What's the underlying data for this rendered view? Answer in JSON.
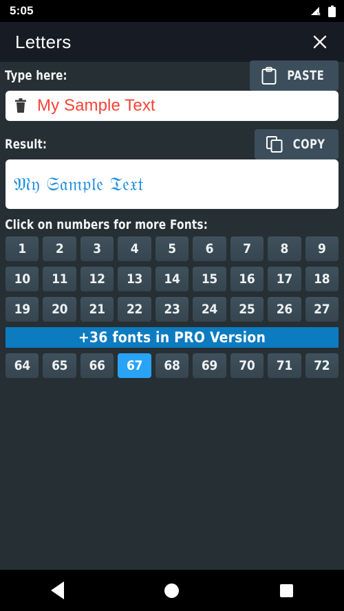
{
  "status_bar": {
    "time": "5:05",
    "signal_icon": "signal-no-sim-icon",
    "battery_icon": "battery-full-icon"
  },
  "title_bar": {
    "title": "Letters",
    "close_icon": "close-icon"
  },
  "input_section": {
    "label": "Type here:",
    "paste_button": {
      "label": "PASTE",
      "icon": "clipboard-icon"
    },
    "clear_icon": "trash-icon",
    "value": "My Sample Text",
    "placeholder": "Type here",
    "text_color": "#f44336"
  },
  "result_section": {
    "label": "Result:",
    "copy_button": {
      "label": "COPY",
      "icon": "copy-icon"
    },
    "value": "𝔐𝔶 𝔖𝔞𝔪𝔭𝔩𝔢 𝔗𝔢𝔵𝔱",
    "text_color": "#1e8fdb"
  },
  "fonts_section": {
    "hint": "Click on numbers for more Fonts:",
    "rows": [
      [
        "1",
        "2",
        "3",
        "4",
        "5",
        "6",
        "7",
        "8",
        "9"
      ],
      [
        "10",
        "11",
        "12",
        "13",
        "14",
        "15",
        "16",
        "17",
        "18"
      ],
      [
        "19",
        "20",
        "21",
        "22",
        "23",
        "24",
        "25",
        "26",
        "27"
      ]
    ],
    "pro_banner": "+36 fonts in PRO Version",
    "pro_rows": [
      [
        "64",
        "65",
        "66",
        "67",
        "68",
        "69",
        "70",
        "71",
        "72"
      ]
    ],
    "selected": "67",
    "selected_color": "#28a3f5",
    "banner_color": "#0d7bc0"
  },
  "nav_bar": {
    "back_icon": "back-triangle-icon",
    "home_icon": "home-circle-icon",
    "recents_icon": "recents-square-icon"
  }
}
